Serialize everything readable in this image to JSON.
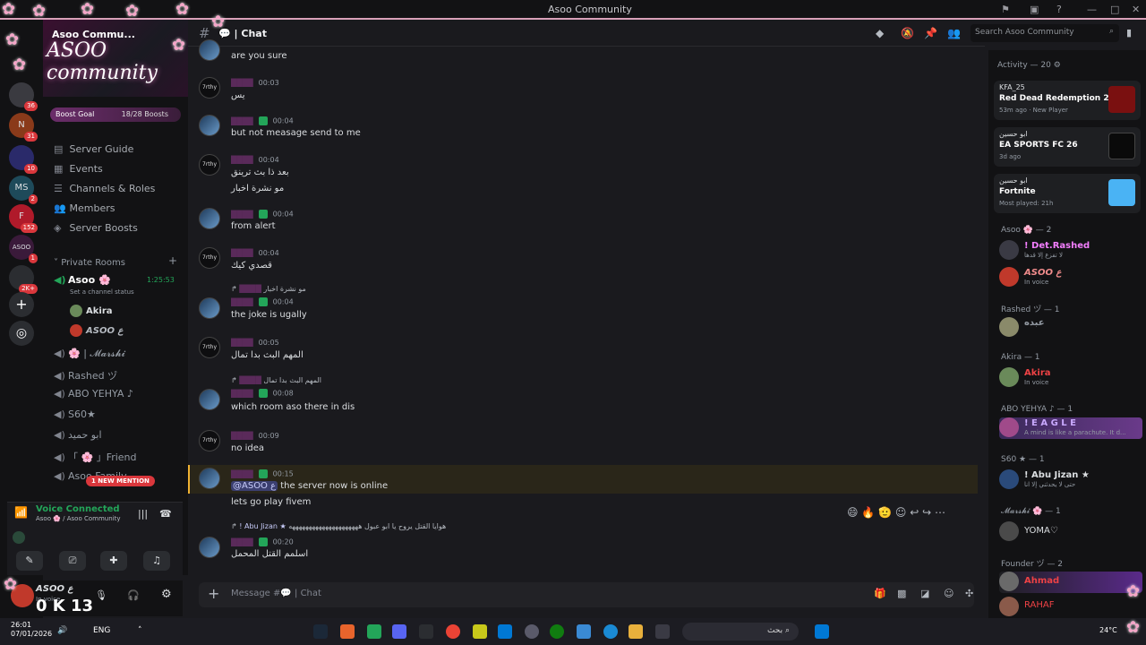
{
  "window": {
    "title": "Asoo Community"
  },
  "server": {
    "name": "Asoo Commu...",
    "logo": "ASOO community",
    "boost_label": "Boost Goal",
    "boost_count": "18/28 Boosts",
    "boost_progress": 0.64
  },
  "guilds": [
    {
      "label": "",
      "badge": "36"
    },
    {
      "label": "N",
      "badge": "31"
    },
    {
      "label": "",
      "badge": "10"
    },
    {
      "label": "MS",
      "badge": "2"
    },
    {
      "label": "F",
      "badge": "152"
    },
    {
      "label": "ASOO",
      "badge": "1"
    },
    {
      "label": "",
      "badge": "2K+"
    }
  ],
  "nav": [
    "Server Guide",
    "Events",
    "Channels & Roles",
    "Members",
    "Server Boosts"
  ],
  "private_rooms": "Private Rooms",
  "asoo_channel": {
    "name": "Asoo 🌸",
    "timer": "1:25:53",
    "status": "Set a channel status"
  },
  "voice_users": [
    "Akira",
    "ASOO ع"
  ],
  "voice_channels": [
    "🌸 | 𝓜𝓪𝓻𝓼𝓱𝓲",
    "Rashed ヅ",
    "ABO YEHYA ♪",
    "S60★",
    "ابو حميد",
    "「 🌸 」Friend",
    "Asoo Family"
  ],
  "mention_badge": "1 NEW MENTION",
  "voice_status": {
    "title": "Voice Connected",
    "sub": "Asoo 🌸 / Asoo Community"
  },
  "user": {
    "name": "ASOO ع",
    "status": "In voice",
    "overlay": "0  K 13"
  },
  "channel": {
    "name": "💬 | Chat",
    "placeholder": "Message #💬 | Chat"
  },
  "search_placeholder": "Search Asoo Community",
  "messages": [
    {
      "time": "",
      "text": "are you sure",
      "avatar": "blue"
    },
    {
      "time": "00:03",
      "text": "يس",
      "avatar": "7rthy"
    },
    {
      "time": "00:04",
      "text": "but not measage send to me",
      "avatar": "blue"
    },
    {
      "time": "00:04",
      "text": "بعد ذا بث ترينق",
      "text2": "مو نشرة اخبار",
      "avatar": "7rthy"
    },
    {
      "time": "00:04",
      "text": "from alert",
      "avatar": "blue"
    },
    {
      "time": "00:04",
      "text": "قصدي كيك",
      "avatar": "7rthy"
    },
    {
      "time": "00:04",
      "text": "the joke is ugally",
      "avatar": "blue",
      "reply": "مو نشرة اخبار"
    },
    {
      "time": "00:05",
      "text": "المهم البث بدا تمال",
      "avatar": "7rthy"
    },
    {
      "time": "00:08",
      "text": "which room aso there in dis",
      "avatar": "blue",
      "reply": "المهم البث بدا تمال"
    },
    {
      "time": "00:09",
      "text": "no idea",
      "avatar": "7rthy"
    },
    {
      "time": "00:15",
      "text": "the server  now is online",
      "mention": "@ASOO ع",
      "text2": "lets go play fivem",
      "avatar": "blue"
    },
    {
      "time": "00:20",
      "text": "اسلمم القتل المحمل",
      "avatar": "blue",
      "reply_user": "! Abu Jizan ★",
      "reply": "هوايا القتل يروح يا ابو عبول هههههههههههههههههههههه"
    }
  ],
  "activity": {
    "label": "Activity — 20"
  },
  "activity_cards": [
    {
      "user": "KFA_25",
      "game": "Red Dead Redemption 2",
      "sub": "53m ago · New Player",
      "color": "#7a1010"
    },
    {
      "user": "ابو حسين",
      "game": "EA SPORTS FC 26",
      "sub": "3d ago",
      "color": "#0a0a0a"
    },
    {
      "user": "ابو حسين",
      "game": "Fortnite",
      "sub": "Most played: 21h",
      "color": "#4ab3f4"
    }
  ],
  "member_groups": [
    {
      "role": "Asoo 🌸 — 2",
      "members": [
        {
          "name": "! Det.Rashed",
          "status": "لا تفزع إلا قدها",
          "color": "#f47fff"
        },
        {
          "name": "ASOO ع",
          "status": "In voice",
          "color": "#f28c8c"
        }
      ]
    },
    {
      "role": "Rashed ヅ — 1",
      "members": [
        {
          "name": "ﻋﺒﺪﻩ",
          "status": "",
          "color": "#949ba4"
        }
      ]
    },
    {
      "role": "Akira — 1",
      "members": [
        {
          "name": "Akira",
          "status": "In voice",
          "color": "#ed4245"
        }
      ]
    },
    {
      "role": "ABO YEHYA ♪ — 1",
      "members": [
        {
          "name": "! E A G L E",
          "status": "A mind is like a parachute. It d...",
          "color": "#c9a9ff"
        }
      ]
    },
    {
      "role": "S60 ★ — 1",
      "members": [
        {
          "name": "! Abu Jizan ★",
          "status": "حتى لا يحدثني إلا انا",
          "color": "#dbdee1"
        }
      ]
    },
    {
      "role": "𝓜𝓪𝓻𝓼𝓱𝓲 🌸 — 1",
      "members": [
        {
          "name": "YOMA♡",
          "status": "",
          "color": "#dbdee1"
        }
      ]
    },
    {
      "role": "Founder ヅ — 2",
      "members": [
        {
          "name": "Ahmad",
          "status": "",
          "color": "#ed4245"
        },
        {
          "name": "RAHAF",
          "status": "",
          "color": "#ed4245"
        }
      ]
    }
  ],
  "taskbar": {
    "time": "26:01",
    "date": "07/01/2026",
    "lang": "ENG",
    "search": "بحث",
    "weather": "24°C"
  }
}
